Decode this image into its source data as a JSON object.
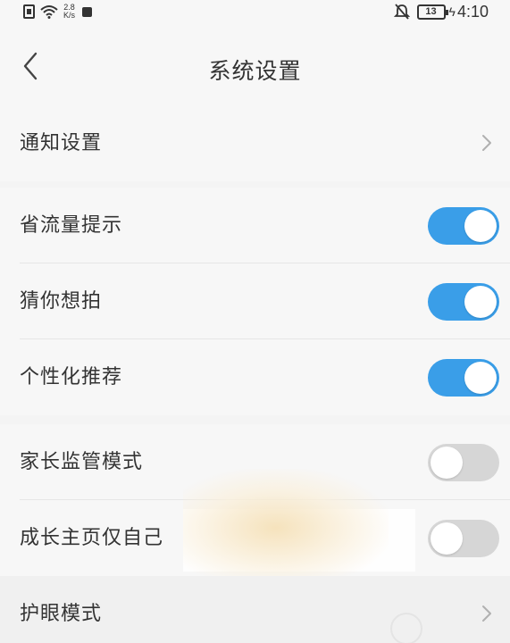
{
  "status_bar": {
    "speed_value": "2.8",
    "speed_unit": "K/s",
    "battery_level": "13",
    "time": "4:10",
    "icons": [
      "sim-icon",
      "wifi-icon",
      "app-icon",
      "mute-icon",
      "battery-icon",
      "charging-icon"
    ]
  },
  "nav": {
    "title": "系统设置",
    "back_icon": "chevron-left-icon"
  },
  "groups": [
    {
      "items": [
        {
          "label": "通知设置",
          "type": "link"
        }
      ]
    },
    {
      "items": [
        {
          "label": "省流量提示",
          "type": "toggle",
          "on": true
        },
        {
          "label": "猜你想拍",
          "type": "toggle",
          "on": true
        },
        {
          "label": "个性化推荐",
          "type": "toggle",
          "on": true
        }
      ]
    },
    {
      "items": [
        {
          "label": "家长监管模式",
          "type": "toggle",
          "on": false
        },
        {
          "label": "成长主页仅自己",
          "type": "toggle",
          "on": false
        },
        {
          "label": "护眼模式",
          "type": "link"
        }
      ]
    }
  ],
  "colors": {
    "toggle_on": "#3a9ee8",
    "toggle_off": "#d6d6d6",
    "background": "#f4f4f4",
    "surface": "#f7f7f7",
    "text": "#333333",
    "chevron": "#b0b0b0"
  }
}
